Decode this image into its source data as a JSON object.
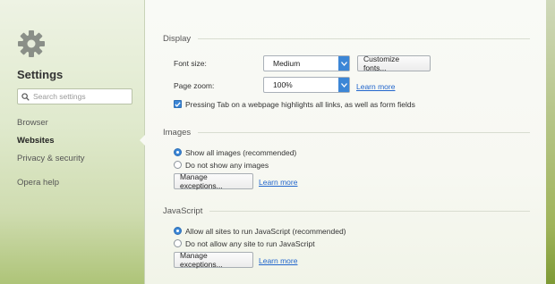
{
  "sidebar": {
    "title": "Settings",
    "search_placeholder": "Search settings",
    "items": [
      {
        "label": "Browser"
      },
      {
        "label": "Websites"
      },
      {
        "label": "Privacy & security"
      },
      {
        "label": "Opera help"
      }
    ],
    "active_item": "Websites"
  },
  "display": {
    "header": "Display",
    "font_size_label": "Font size:",
    "font_size_value": "Medium",
    "customize_fonts_button": "Customize fonts...",
    "page_zoom_label": "Page zoom:",
    "page_zoom_value": "100%",
    "learn_more": "Learn more",
    "tab_highlight_label": "Pressing Tab on a webpage highlights all links, as well as form fields",
    "tab_highlight_checked": true
  },
  "images": {
    "header": "Images",
    "option_show": "Show all images (recommended)",
    "option_hide": "Do not show any images",
    "selected": "show",
    "manage_exceptions": "Manage exceptions...",
    "learn_more": "Learn more"
  },
  "javascript": {
    "header": "JavaScript",
    "option_allow": "Allow all sites to run JavaScript (recommended)",
    "option_block": "Do not allow any site to run JavaScript",
    "selected": "allow",
    "manage_exceptions": "Manage exceptions...",
    "learn_more": "Learn more"
  },
  "colors": {
    "accent": "#3b86d6",
    "link": "#2266cc"
  },
  "icons": [
    "gear-icon",
    "search-icon",
    "chevron-down-icon",
    "checkmark-icon"
  ]
}
